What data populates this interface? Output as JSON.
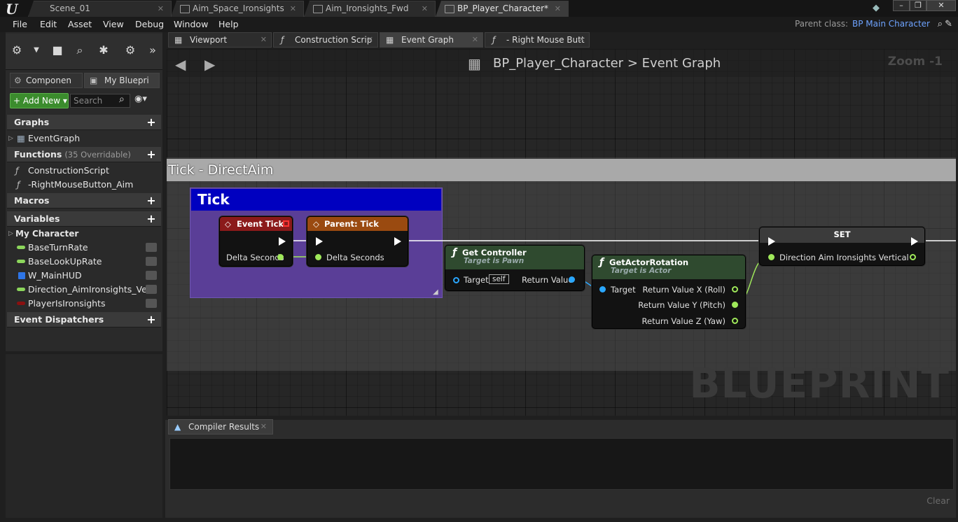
{
  "titlebar": {
    "tabs": [
      {
        "label": "Scene_01",
        "active": false
      },
      {
        "label": "Aim_Space_Ironsights",
        "active": false
      },
      {
        "label": "Aim_Ironsights_Fwd",
        "active": false
      },
      {
        "label": "BP_Player_Character*",
        "active": true
      }
    ]
  },
  "menu": {
    "items": [
      "File",
      "Edit",
      "Asset",
      "View",
      "Debug",
      "Window",
      "Help"
    ],
    "parent_class_label": "Parent class:",
    "parent_class_value": "BP Main Character"
  },
  "editor_tabs": [
    {
      "label": "Viewport"
    },
    {
      "label": "Construction Scrip"
    },
    {
      "label": "Event Graph"
    },
    {
      "label": "- Right Mouse Butt"
    }
  ],
  "left": {
    "panel_tabs": [
      "Componen",
      "My Bluepri"
    ],
    "add_new_label": "Add New",
    "search_placeholder": "Search",
    "sections": {
      "graphs": "Graphs",
      "functions": "Functions",
      "functions_sub": "(35 Overridable)",
      "macros": "Macros",
      "variables": "Variables",
      "event_dispatchers": "Event Dispatchers"
    },
    "graph_items": [
      "EventGraph"
    ],
    "function_items": [
      "ConstructionScript",
      "-RightMouseButton_Aim"
    ],
    "variables_category": "My Character",
    "variables": [
      {
        "name": "BaseTurnRate",
        "color": "#8cd65c"
      },
      {
        "name": "BaseLookUpRate",
        "color": "#8cd65c"
      },
      {
        "name": "W_MainHUD",
        "color": "#2e75e6"
      },
      {
        "name": "Direction_AimIronsights_Ver",
        "color": "#8cd65c"
      },
      {
        "name": "PlayerIsIronsights",
        "color": "#8a1010"
      }
    ]
  },
  "graph": {
    "breadcrumb_root": "BP_Player_Character",
    "breadcrumb_sep": ">",
    "breadcrumb_leaf": "Event Graph",
    "zoom": "Zoom -1",
    "comment_title": "Tick - DirectAim",
    "tick_comment": "Tick",
    "watermark": "BLUEPRINT",
    "nodes": {
      "event_tick": {
        "title": "Event Tick",
        "pin": "Delta Seconds"
      },
      "parent_tick": {
        "title": "Parent: Tick",
        "pin": "Delta Seconds"
      },
      "get_controller": {
        "title": "Get Controller",
        "subtitle": "Target is Pawn",
        "target": "Target",
        "self": "self",
        "ret": "Return Value"
      },
      "get_actor_rotation": {
        "title": "GetActorRotation",
        "subtitle": "Target is Actor",
        "target": "Target",
        "ret_x": "Return Value X (Roll)",
        "ret_y": "Return Value Y (Pitch)",
        "ret_z": "Return Value Z (Yaw)"
      },
      "set": {
        "title": "SET",
        "pin": "Direction Aim Ironsights Vertical"
      }
    }
  },
  "bottom": {
    "tab": "Compiler Results",
    "clear": "Clear"
  },
  "colors": {
    "exec_red": "#8b1a1a",
    "parent_orange": "#9a4a10",
    "func_green": "#2f4a2f",
    "float_green": "#9fe85a",
    "object_blue": "#2aa7ff"
  }
}
